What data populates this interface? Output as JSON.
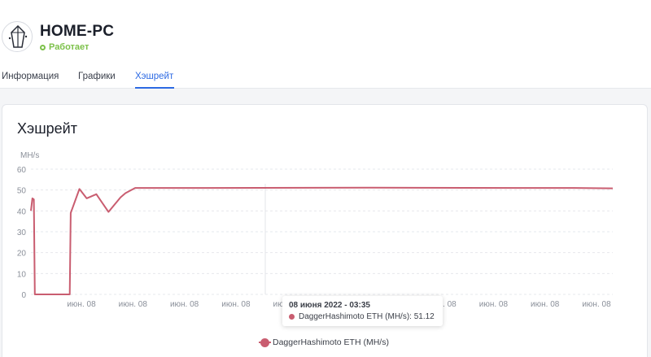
{
  "header": {
    "title": "HOME-PC",
    "status": "Работает",
    "status_color": "#7cc14a"
  },
  "tabs": [
    {
      "label": "Информация",
      "active": false
    },
    {
      "label": "Графики",
      "active": false
    },
    {
      "label": "Хэшрейт",
      "active": true
    }
  ],
  "card": {
    "title": "Хэшрейт"
  },
  "tooltip": {
    "date": "08 июня 2022 - 03:35",
    "series_label": "DaggerHashimoto ETH (MH/s): 51.12"
  },
  "legend": {
    "label": "DaggerHashimoto ETH (MH/s)"
  },
  "chart_data": {
    "type": "line",
    "ylabel": "MH/s",
    "ylim": [
      0,
      60
    ],
    "yticks": [
      0,
      10,
      20,
      30,
      40,
      50,
      60
    ],
    "grid": true,
    "x_tick_labels": [
      "июн. 08",
      "июн. 08",
      "июн. 08",
      "июн. 08",
      "июн. 08",
      "июн. 08",
      "июн. 08",
      "июн. 08",
      "июн. 08",
      "июн. 08",
      "июн. 08"
    ],
    "series": [
      {
        "name": "DaggerHashimoto ETH (MH/s)",
        "color": "#c95d70",
        "x": [
          0,
          0.3,
          0.6,
          0.8,
          1,
          8,
          8.2,
          10,
          11.5,
          13.5,
          16,
          18.5,
          19.5,
          21.5,
          36,
          70,
          100,
          112,
          120
        ],
        "values": [
          40,
          46,
          45.5,
          0,
          0,
          0,
          39,
          50.5,
          46,
          48,
          39.5,
          46.5,
          48.5,
          51,
          51,
          51.1,
          51,
          51,
          50.8
        ]
      }
    ]
  }
}
